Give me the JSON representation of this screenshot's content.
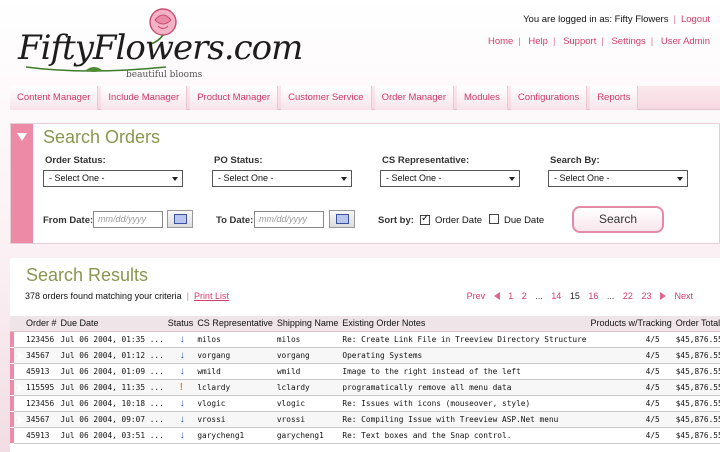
{
  "brand": {
    "logo_text": "FiftyFlowers.com",
    "tagline": "beautiful blooms"
  },
  "header": {
    "logged_in_text": "You are logged in as: Fifty Flowers",
    "logout_label": "Logout",
    "links": [
      "Home",
      "Help",
      "Support",
      "Settings",
      "User Admin"
    ]
  },
  "nav": {
    "tabs": [
      "Content Manager",
      "Include Manager",
      "Product Manager",
      "Customer Service",
      "Order Manager",
      "Modules",
      "Configurations",
      "Reports"
    ]
  },
  "search": {
    "title": "Search Orders",
    "order_status": {
      "label": "Order Status:",
      "value": "- Select One -"
    },
    "po_status": {
      "label": "PO Status:",
      "value": "- Select One -"
    },
    "cs_rep": {
      "label": "CS Representative:",
      "value": "- Select One -"
    },
    "search_by": {
      "label": "Search By:",
      "value": "- Select One -"
    },
    "from_date": {
      "label": "From Date:",
      "placeholder": "mm/dd/yyyy"
    },
    "to_date": {
      "label": "To Date:",
      "placeholder": "mm/dd/yyyy"
    },
    "sort_by_label": "Sort by:",
    "sort_order_date": {
      "label": "Order Date",
      "checked": true
    },
    "sort_due_date": {
      "label": "Due Date",
      "checked": false
    },
    "button_label": "Search"
  },
  "results": {
    "title": "Search Results",
    "found_text": "378 orders found matching your criteria",
    "print_label": "Print List",
    "pager": {
      "prev": "Prev",
      "next": "Next",
      "pages": [
        "1",
        "2",
        "...",
        "14",
        "15",
        "16",
        "...",
        "22",
        "23"
      ],
      "current": "15"
    },
    "columns": [
      "Order #",
      "Due Date",
      "Status",
      "CS Representative",
      "Shipping Name",
      "Existing Order Notes",
      "Products w/Tracking",
      "Order Total"
    ],
    "rows": [
      {
        "order": "123456",
        "due": "Jul 06 2004, 01:35 ...",
        "status": "down-arrow-icon",
        "rep": "milos",
        "ship": "milos",
        "notes": "Re: Create Link File in Treeview Directory Structure",
        "tracking": "4/5",
        "total": "$45,876.55"
      },
      {
        "order": "34567",
        "due": "Jul 06 2004, 01:12 ...",
        "status": "down-arrow-icon",
        "rep": "vorgang",
        "ship": "vorgang",
        "notes": "Operating Systems",
        "tracking": "4/5",
        "total": "$45,876.55"
      },
      {
        "order": "45913",
        "due": "Jul 06 2004, 01:09 ...",
        "status": "down-arrow-icon",
        "rep": "wmild",
        "ship": "wmild",
        "notes": "Image to the right instead of the left",
        "tracking": "4/5",
        "total": "$45,876.55"
      },
      {
        "order": "115595",
        "due": "Jul 06 2004, 11:35 ...",
        "status": "exclamation-icon",
        "rep": "lclardy",
        "ship": "lclardy",
        "notes": "programatically remove all menu data",
        "tracking": "4/5",
        "total": "$45,876.55"
      },
      {
        "order": "123456",
        "due": "Jul 06 2004, 10:18 ...",
        "status": "down-arrow-icon",
        "rep": "vlogic",
        "ship": "vlogic",
        "notes": "Re: Issues with icons (mouseover, style)",
        "tracking": "4/5",
        "total": "$45,876.55"
      },
      {
        "order": "34567",
        "due": "Jul 06 2004, 09:07 ...",
        "status": "down-arrow-icon",
        "rep": "vrossi",
        "ship": "vrossi",
        "notes": "Re: Compiling Issue with Treeview ASP.Net menu",
        "tracking": "4/5",
        "total": "$45,876.55"
      },
      {
        "order": "45913",
        "due": "Jul 06 2004, 03:51 ...",
        "status": "down-arrow-icon",
        "rep": "garycheng1",
        "ship": "garycheng1",
        "notes": "Re: Text boxes and the Snap control.",
        "tracking": "4/5",
        "total": "$45,876.55"
      }
    ]
  },
  "colors": {
    "accent_pink": "#ed8aa6",
    "link": "#d43d6b",
    "title_olive": "#8b9550"
  }
}
